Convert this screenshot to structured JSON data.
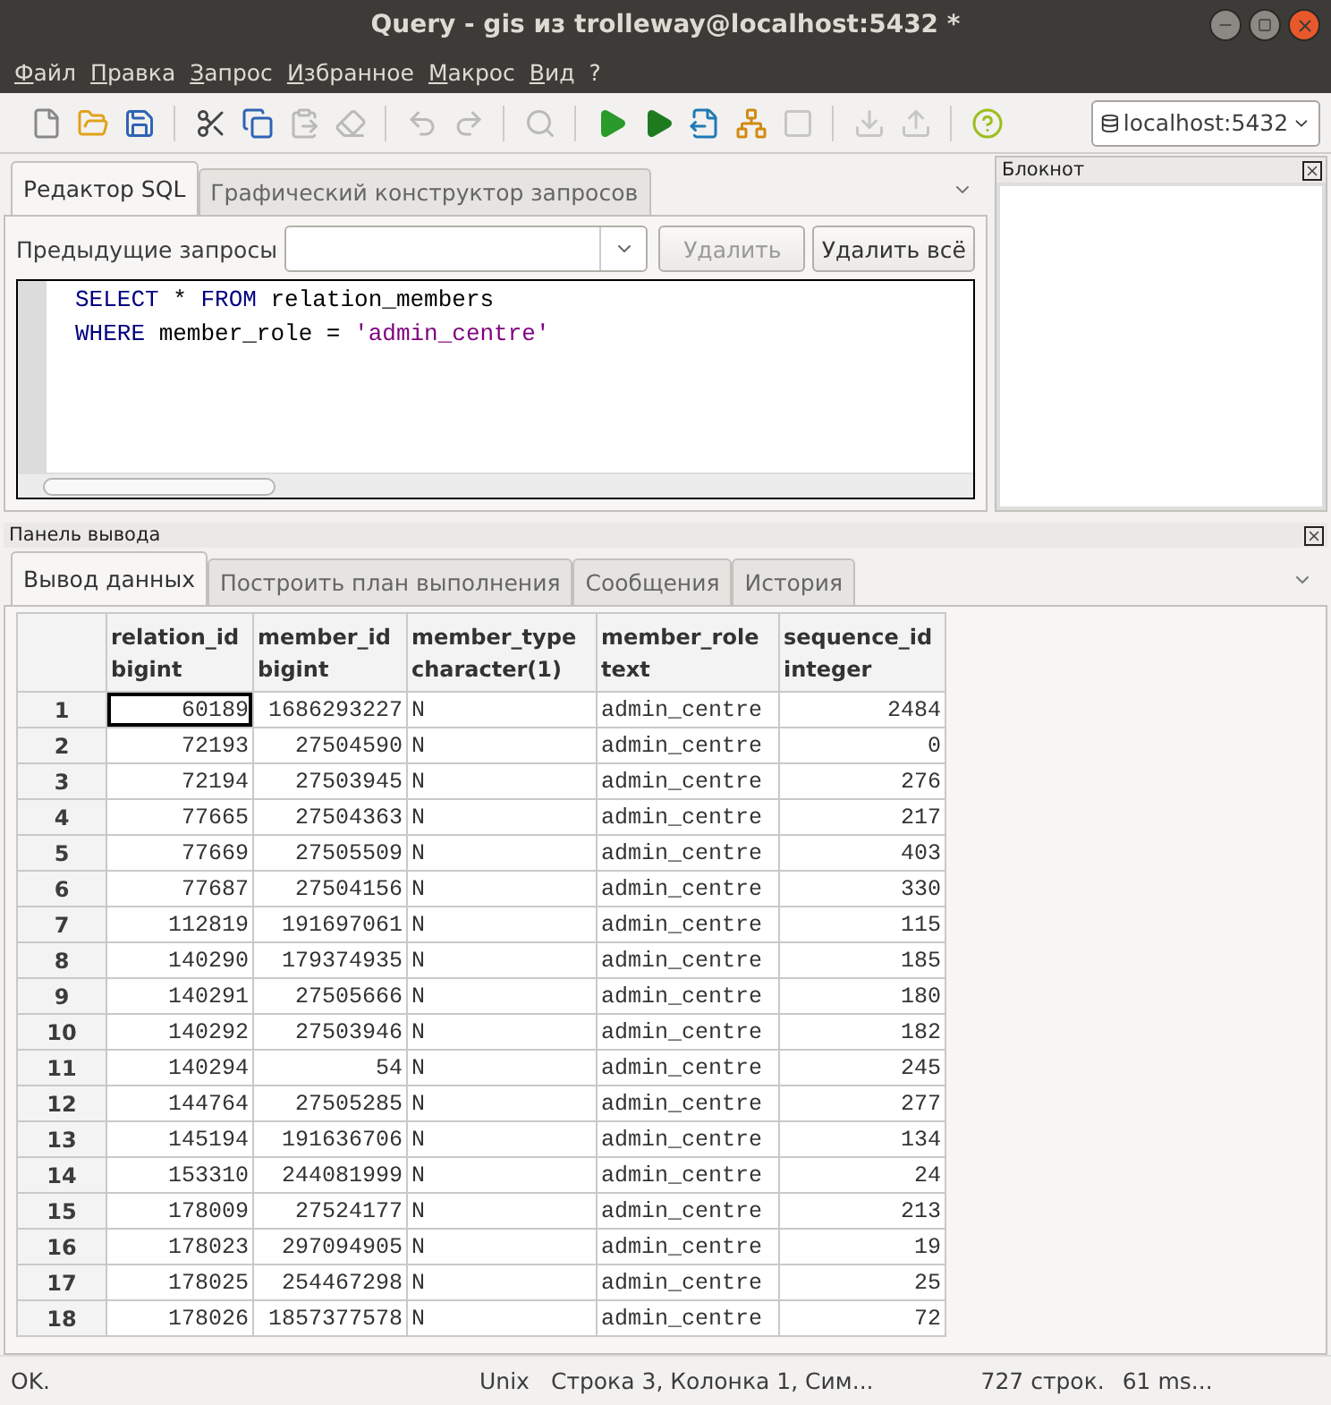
{
  "window": {
    "title": "Query - gis из trolleway@localhost:5432 *"
  },
  "menu": [
    "Файл",
    "Правка",
    "Запрос",
    "Избранное",
    "Макрос",
    "Вид",
    "?"
  ],
  "toolbar": [
    {
      "kind": "new",
      "disabled": false
    },
    {
      "kind": "open",
      "disabled": false
    },
    {
      "kind": "save",
      "disabled": false
    },
    {
      "kind": "sep"
    },
    {
      "kind": "cut",
      "disabled": false
    },
    {
      "kind": "copy",
      "disabled": false
    },
    {
      "kind": "paste",
      "disabled": true
    },
    {
      "kind": "clear",
      "disabled": true
    },
    {
      "kind": "sep"
    },
    {
      "kind": "undo",
      "disabled": true
    },
    {
      "kind": "redo",
      "disabled": true
    },
    {
      "kind": "sep"
    },
    {
      "kind": "find",
      "disabled": true
    },
    {
      "kind": "sep"
    },
    {
      "kind": "run",
      "disabled": false
    },
    {
      "kind": "pgscript",
      "disabled": false
    },
    {
      "kind": "runfile",
      "disabled": false
    },
    {
      "kind": "explain",
      "disabled": false
    },
    {
      "kind": "stop",
      "disabled": true
    },
    {
      "kind": "sep"
    },
    {
      "kind": "down",
      "disabled": true
    },
    {
      "kind": "up",
      "disabled": true
    },
    {
      "kind": "sep"
    },
    {
      "kind": "help",
      "disabled": false
    }
  ],
  "connection": "localhost:5432",
  "editor_tabs": [
    {
      "label": "Редактор SQL",
      "selected": true
    },
    {
      "label": "Графический конструктор запросов",
      "selected": false
    }
  ],
  "previous_queries": {
    "label": "Предыдущие запросы",
    "delete": "Удалить",
    "delete_disabled": true,
    "delete_all": "Удалить всё"
  },
  "sql": [
    [
      {
        "kind": "keyword",
        "text": "SELECT"
      },
      {
        "kind": "plain",
        "text": " * "
      },
      {
        "kind": "keyword",
        "text": "FROM"
      },
      {
        "kind": "plain",
        "text": " relation_members"
      }
    ],
    [
      {
        "kind": "keyword",
        "text": "WHERE"
      },
      {
        "kind": "plain",
        "text": " member_role = "
      },
      {
        "kind": "string",
        "text": "'admin_centre'"
      }
    ]
  ],
  "notepad": {
    "title": "Блокнот"
  },
  "output": {
    "title": "Панель вывода",
    "tabs": [
      {
        "label": "Вывод данных",
        "selected": true
      },
      {
        "label": "Построить план выполнения",
        "selected": false
      },
      {
        "label": "Сообщения",
        "selected": false
      },
      {
        "label": "История",
        "selected": false
      }
    ],
    "columns": [
      {
        "name": "relation_id",
        "type": "bigint",
        "kind": "number"
      },
      {
        "name": "member_id",
        "type": "bigint",
        "kind": "number"
      },
      {
        "name": "member_type",
        "type": "character(1)",
        "kind": "text"
      },
      {
        "name": "member_role",
        "type": "text",
        "kind": "text"
      },
      {
        "name": "sequence_id",
        "type": "integer",
        "kind": "number"
      }
    ],
    "rows": [
      {
        "number": "1",
        "focused": true,
        "cells": [
          "60189",
          "1686293227",
          "N",
          "admin_centre",
          "2484"
        ]
      },
      {
        "number": "2",
        "focused": false,
        "cells": [
          "72193",
          "27504590",
          "N",
          "admin_centre",
          "0"
        ]
      },
      {
        "number": "3",
        "focused": false,
        "cells": [
          "72194",
          "27503945",
          "N",
          "admin_centre",
          "276"
        ]
      },
      {
        "number": "4",
        "focused": false,
        "cells": [
          "77665",
          "27504363",
          "N",
          "admin_centre",
          "217"
        ]
      },
      {
        "number": "5",
        "focused": false,
        "cells": [
          "77669",
          "27505509",
          "N",
          "admin_centre",
          "403"
        ]
      },
      {
        "number": "6",
        "focused": false,
        "cells": [
          "77687",
          "27504156",
          "N",
          "admin_centre",
          "330"
        ]
      },
      {
        "number": "7",
        "focused": false,
        "cells": [
          "112819",
          "191697061",
          "N",
          "admin_centre",
          "115"
        ]
      },
      {
        "number": "8",
        "focused": false,
        "cells": [
          "140290",
          "179374935",
          "N",
          "admin_centre",
          "185"
        ]
      },
      {
        "number": "9",
        "focused": false,
        "cells": [
          "140291",
          "27505666",
          "N",
          "admin_centre",
          "180"
        ]
      },
      {
        "number": "10",
        "focused": false,
        "cells": [
          "140292",
          "27503946",
          "N",
          "admin_centre",
          "182"
        ]
      },
      {
        "number": "11",
        "focused": false,
        "cells": [
          "140294",
          "54",
          "N",
          "admin_centre",
          "245"
        ]
      },
      {
        "number": "12",
        "focused": false,
        "cells": [
          "144764",
          "27505285",
          "N",
          "admin_centre",
          "277"
        ]
      },
      {
        "number": "13",
        "focused": false,
        "cells": [
          "145194",
          "191636706",
          "N",
          "admin_centre",
          "134"
        ]
      },
      {
        "number": "14",
        "focused": false,
        "cells": [
          "153310",
          "244081999",
          "N",
          "admin_centre",
          "24"
        ]
      },
      {
        "number": "15",
        "focused": false,
        "cells": [
          "178009",
          "27524177",
          "N",
          "admin_centre",
          "213"
        ]
      },
      {
        "number": "16",
        "focused": false,
        "cells": [
          "178023",
          "297094905",
          "N",
          "admin_centre",
          "19"
        ]
      },
      {
        "number": "17",
        "focused": false,
        "cells": [
          "178025",
          "254467298",
          "N",
          "admin_centre",
          "25"
        ]
      },
      {
        "number": "18",
        "focused": false,
        "cells": [
          "178026",
          "1857377578",
          "N",
          "admin_centre",
          "72"
        ]
      }
    ]
  },
  "status_bar": {
    "message": "OK.",
    "line_endings": "Unix",
    "position": "Строка 3, Колонка 1, Сим...",
    "rows": "727 строк.",
    "time": "61 ms..."
  }
}
